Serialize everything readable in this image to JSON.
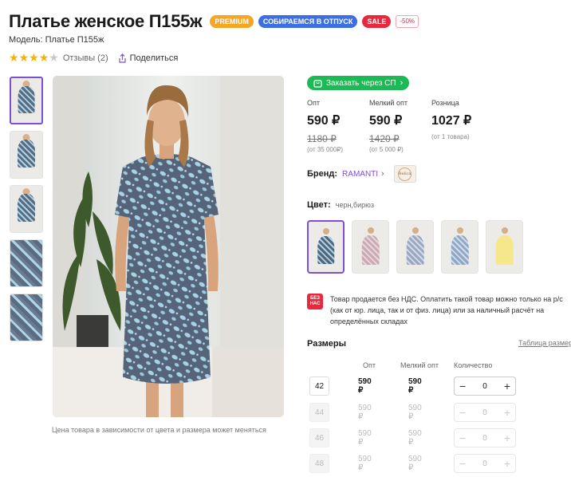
{
  "product": {
    "title": "Платье женское П155ж",
    "badges": [
      "PREMIUM",
      "СОБИРАЕМСЯ В ОТПУСК",
      "SALE",
      "-50%"
    ],
    "model": "Модель: Платье П155ж",
    "rating": 4,
    "rating_max": 5,
    "reviews": "Отзывы (2)",
    "share": "Поделиться"
  },
  "gallery": {
    "thumbnails_count": 5,
    "note": "Цена товара в зависимости от цвета и размера может меняться"
  },
  "order_button": "Заказать через СП",
  "prices": [
    {
      "label": "Опт",
      "price": "590 ₽",
      "old": "1180 ₽",
      "note": "(от 35 000₽)"
    },
    {
      "label": "Мелкий опт",
      "price": "590 ₽",
      "old": "1420 ₽",
      "note": "(от 5 000 ₽)"
    },
    {
      "label": "Розница",
      "price": "1027 ₽",
      "old": "",
      "note": "(от 1 товара)"
    }
  ],
  "brand": {
    "label": "Бренд:",
    "name": "RAMANTI",
    "logo_text": "Belica"
  },
  "color": {
    "label": "Цвет:",
    "value": "черн,бирюз"
  },
  "nds": {
    "icon": "БЕЗ НАС",
    "lines": [
      "Товар продается без НДС. Оплатить такой товар можно только на р/с",
      "(как от юр. лица, так и от физ. лица) или за наличный расчёт на",
      "определённых складах"
    ]
  },
  "sizes": {
    "title": "Размеры",
    "table_link": "Таблица размеров",
    "headers": [
      "Опт",
      "Мелкий опт",
      "Количество"
    ],
    "rows": [
      {
        "size": "42",
        "opt": "590 ₽",
        "small": "590 ₽",
        "qty": "0"
      },
      {
        "size": "44",
        "opt": "590 ₽",
        "small": "590 ₽",
        "qty": "0"
      },
      {
        "size": "46",
        "opt": "590 ₽",
        "small": "590 ₽",
        "qty": "0"
      },
      {
        "size": "48",
        "opt": "590 ₽",
        "small": "590 ₽",
        "qty": "0"
      }
    ]
  },
  "colors": {
    "accent": "#7b4fd6",
    "green": "#1db954",
    "red": "#e8283c",
    "star": "#f5b400"
  }
}
